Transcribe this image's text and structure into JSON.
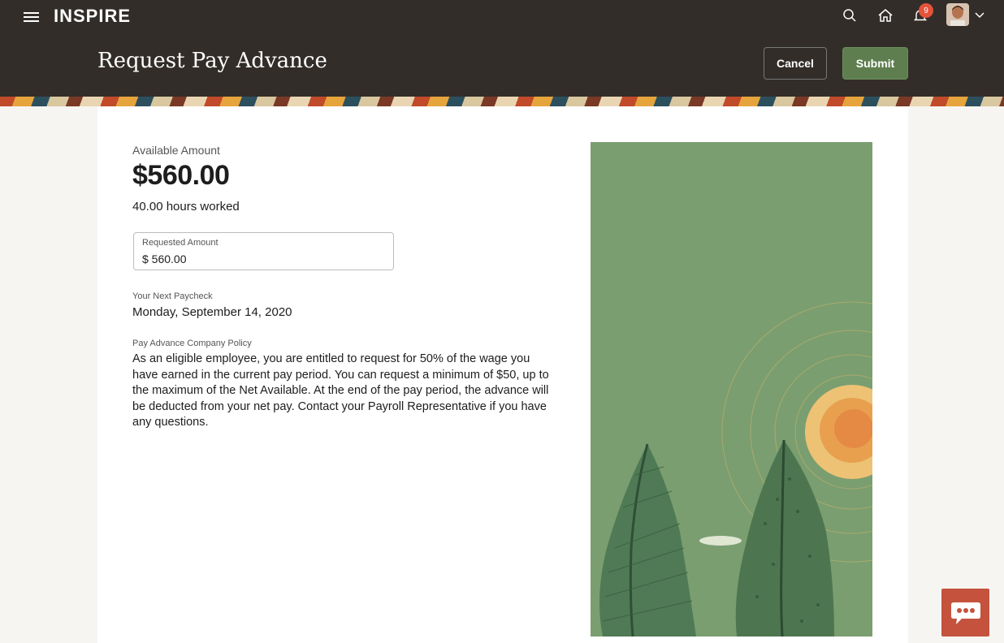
{
  "app": {
    "logo": "INSPIRE"
  },
  "header": {
    "page_title": "Request Pay Advance",
    "cancel_label": "Cancel",
    "submit_label": "Submit",
    "notification_count": "9",
    "icons": [
      "menu-icon",
      "search-icon",
      "home-icon",
      "notifications-icon",
      "avatar",
      "chevron-down-icon"
    ]
  },
  "form": {
    "available_label": "Available Amount",
    "available_amount": "$560.00",
    "hours_worked": "40.00 hours worked",
    "requested": {
      "label": "Requested Amount",
      "value": "$ 560.00"
    },
    "next_paycheck": {
      "label": "Your Next Paycheck",
      "value": "Monday, September 14, 2020"
    },
    "policy": {
      "label": "Pay Advance Company Policy",
      "text": "As an eligible employee, you are entitled to request for 50% of the wage you have earned in the current pay period. You can request a minimum of $50, up to the maximum of the Net Available. At the end of the pay period, the advance will be deducted from your net pay. Contact your Payroll Representative if you have any questions."
    }
  },
  "colors": {
    "header_bg": "#322d29",
    "submit_bg": "#5e7e4f",
    "art_bg": "#7a9e70",
    "chat_bg": "#c4523d",
    "badge": "#e5523a"
  }
}
